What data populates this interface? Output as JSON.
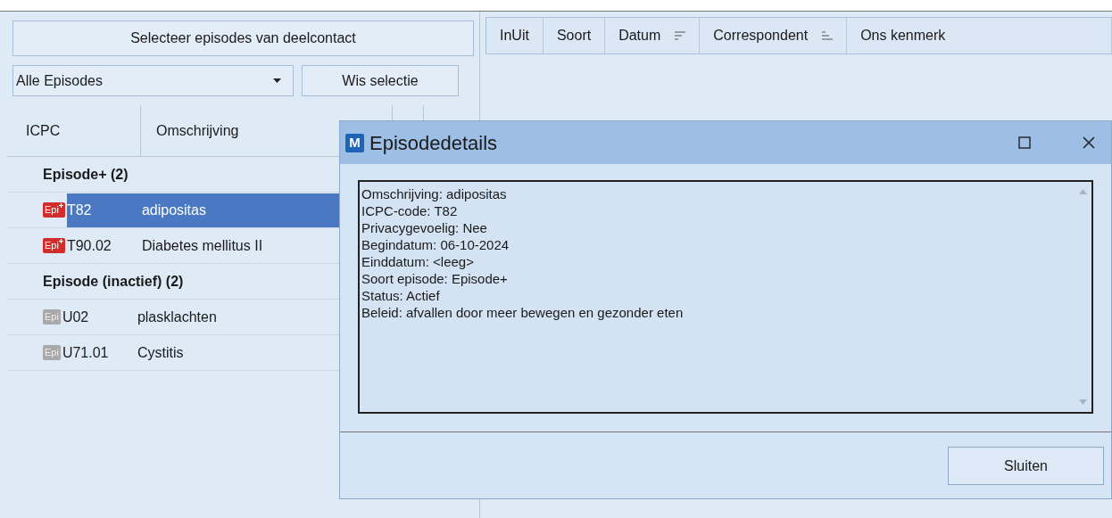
{
  "left_panel": {
    "select_button": "Selecteer episodes van deelcontact",
    "filter_dropdown": {
      "value": "Alle Episodes"
    },
    "clear_button": "Wis selectie",
    "columns": [
      "ICPC",
      "Omschrijving"
    ],
    "groups": [
      {
        "title": "Episode+ (2)",
        "kind": "active",
        "episodes": [
          {
            "badge": "Epi",
            "code": "T82",
            "description": "adipositas",
            "selected": true
          },
          {
            "badge": "Epi",
            "code": "T90.02",
            "description": "Diabetes mellitus II",
            "selected": false
          }
        ]
      },
      {
        "title": "Episode (inactief) (2)",
        "kind": "inactive",
        "episodes": [
          {
            "badge": "Epi",
            "code": "U02",
            "description": "plasklachten",
            "selected": false
          },
          {
            "badge": "Epi",
            "code": "U71.01",
            "description": "Cystitis",
            "selected": false
          }
        ]
      }
    ]
  },
  "right_panel": {
    "columns": [
      {
        "label": "InUit",
        "kind": "plain"
      },
      {
        "label": "Soort",
        "kind": "plain"
      },
      {
        "label": "Datum",
        "kind": "descending"
      },
      {
        "label": "Correspondent",
        "kind": "ascending"
      },
      {
        "label": "Ons kenmerk",
        "kind": "plain"
      }
    ]
  },
  "dialog": {
    "logo": "M",
    "title": "Episodedetails",
    "details": [
      "Omschrijving: adipositas",
      "ICPC-code: T82",
      "Privacygevoelig: Nee",
      "Begindatum: 06-10-2024",
      "Einddatum: <leeg>",
      "Soort episode: Episode+",
      "Status: Actief",
      "Beleid: afvallen door meer bewegen en gezonder eten"
    ],
    "close_button": "Sluiten"
  }
}
